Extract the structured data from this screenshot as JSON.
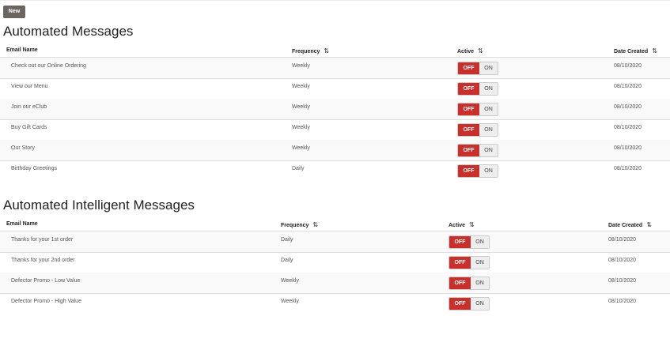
{
  "toolbar": {
    "new_label": "New"
  },
  "sections": [
    {
      "title": "Automated Messages",
      "columns": {
        "name": "Email Name",
        "frequency": "Frequency",
        "active": "Active",
        "date": "Date Created"
      },
      "rows": [
        {
          "name": "Check out our Online Ordering",
          "frequency": "Weekly",
          "off": "OFF",
          "on": "ON",
          "date": "08/10/2020"
        },
        {
          "name": "View our Menu",
          "frequency": "Weekly",
          "off": "OFF",
          "on": "ON",
          "date": "08/10/2020"
        },
        {
          "name": "Join our eClub",
          "frequency": "Weekly",
          "off": "OFF",
          "on": "ON",
          "date": "08/10/2020"
        },
        {
          "name": "Buy Gift Cards",
          "frequency": "Weekly",
          "off": "OFF",
          "on": "ON",
          "date": "08/10/2020"
        },
        {
          "name": "Our Story",
          "frequency": "Weekly",
          "off": "OFF",
          "on": "ON",
          "date": "08/10/2020"
        },
        {
          "name": "Birthday Greetings",
          "frequency": "Daily",
          "off": "OFF",
          "on": "ON",
          "date": "08/10/2020"
        }
      ]
    },
    {
      "title": "Automated Intelligent Messages",
      "columns": {
        "name": "Email Name",
        "frequency": "Frequency",
        "active": "Active",
        "date": "Date Created"
      },
      "rows": [
        {
          "name": "Thanks for your 1st order",
          "frequency": "Daily",
          "off": "OFF",
          "on": "ON",
          "date": "08/10/2020"
        },
        {
          "name": "Thanks for your 2nd order",
          "frequency": "Daily",
          "off": "OFF",
          "on": "ON",
          "date": "08/10/2020"
        },
        {
          "name": "Defector Promo - Low Value",
          "frequency": "Weekly",
          "off": "OFF",
          "on": "ON",
          "date": "08/10/2020"
        },
        {
          "name": "Defector Promo - High Value",
          "frequency": "Weekly",
          "off": "OFF",
          "on": "ON",
          "date": "08/10/2020"
        }
      ]
    }
  ],
  "icons": {
    "sort": "sort-arrows-icon"
  },
  "colors": {
    "toggle_off": "#c9302c",
    "new_button": "#6d6560"
  }
}
